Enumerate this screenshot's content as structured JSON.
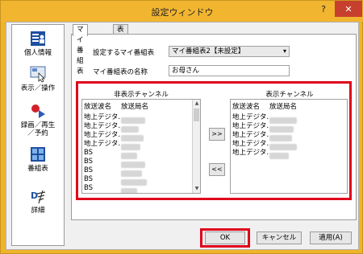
{
  "window": {
    "title": "設定ウィンドウ",
    "help_glyph": "?",
    "close_glyph": "✕"
  },
  "sidebar": {
    "items": [
      {
        "label": "個人情報"
      },
      {
        "label": "表示／操作"
      },
      {
        "label": "録画／再生\n／予約"
      },
      {
        "label": "番組表"
      },
      {
        "label": "詳細"
      }
    ]
  },
  "tabs": [
    {
      "label": "マイ番組表"
    },
    {
      "label": "表示"
    }
  ],
  "form": {
    "set_label": "設定するマイ番組表",
    "set_value": "マイ番組表2【未設定】",
    "name_label": "マイ番組表の名称",
    "name_value": "お母さん"
  },
  "hidden_list": {
    "caption": "非表示チャンネル",
    "col_type": "放送波名",
    "col_station": "放送局名",
    "rows": [
      {
        "type": "地上デジタ…"
      },
      {
        "type": "地上デジタ…"
      },
      {
        "type": "地上デジタ…"
      },
      {
        "type": "地上デジタ…"
      },
      {
        "type": "BS"
      },
      {
        "type": "BS"
      },
      {
        "type": "BS"
      },
      {
        "type": "BS"
      },
      {
        "type": "BS"
      }
    ]
  },
  "shown_list": {
    "caption": "表示チャンネル",
    "col_type": "放送波名",
    "col_station": "放送局名",
    "rows": [
      {
        "type": "地上デジタ…"
      },
      {
        "type": "地上デジタ…"
      },
      {
        "type": "地上デジタ…"
      },
      {
        "type": "地上デジタ…"
      },
      {
        "type": "地上デジタ…"
      }
    ]
  },
  "move": {
    "add": ">>",
    "remove": "<<"
  },
  "buttons": {
    "ok": "OK",
    "cancel": "キャンセル",
    "apply": "適用(A)"
  },
  "colors": {
    "highlight": "#e0001b",
    "titlebar": "#f2b530"
  }
}
